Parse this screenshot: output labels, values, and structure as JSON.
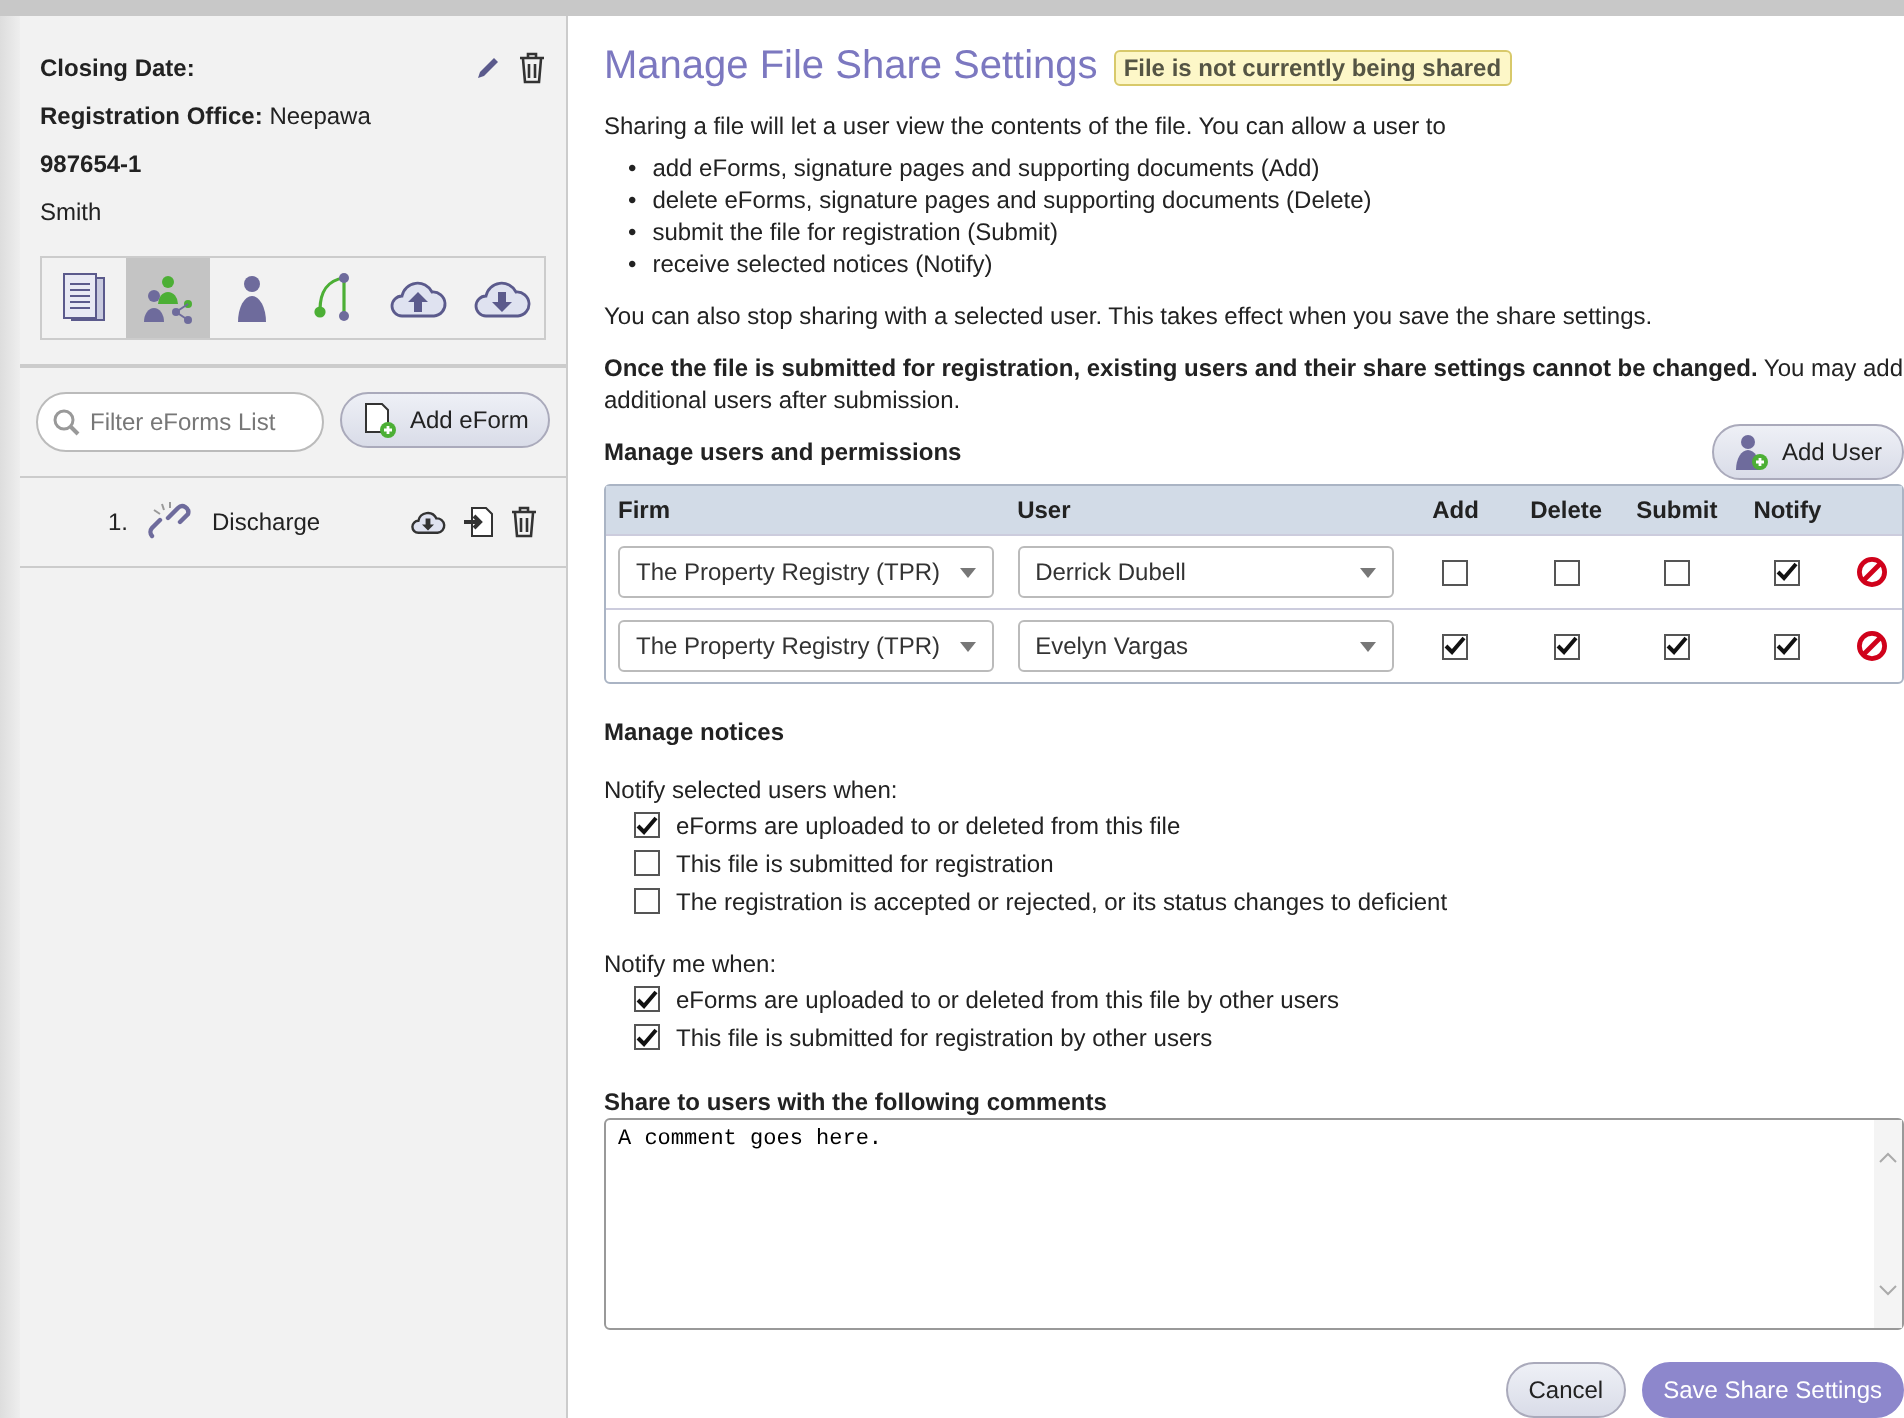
{
  "sidebar": {
    "closing_date_label": "Closing Date:",
    "registration_office_label": "Registration Office:",
    "registration_office": "Neepawa",
    "file_number": "987654-1",
    "name": "Smith",
    "tools": [
      {
        "kind": "document",
        "selected": false
      },
      {
        "kind": "share",
        "selected": true
      },
      {
        "kind": "user",
        "selected": false
      },
      {
        "kind": "branch",
        "selected": false
      },
      {
        "kind": "upload",
        "selected": false
      },
      {
        "kind": "download",
        "selected": false
      }
    ],
    "filter": {
      "placeholder": "Filter eForms List"
    },
    "add_button": "Add eForm",
    "eforms": [
      {
        "number": "1.",
        "name": "Discharge"
      }
    ]
  },
  "main": {
    "title": "Manage File Share Settings",
    "status_badge": "File is not currently being shared",
    "intro": "Sharing a file will let a user view the contents of the file. You can allow a user to",
    "bullets": [
      {
        "marker": "•",
        "text": "add eForms, signature pages and supporting documents (Add)"
      },
      {
        "marker": "•",
        "text": "delete eForms, signature pages and supporting documents (Delete)"
      },
      {
        "marker": "•",
        "text": "submit the file for registration (Submit)"
      },
      {
        "marker": "•",
        "text": "receive selected notices (Notify)"
      }
    ],
    "stop_note": "You can also stop sharing with a selected user. This takes effect when you save the share settings.",
    "submission_note": "**Once the file is submitted for registration, existing users and their share settings cannot be changed.** You may add additional users after submission.",
    "users_heading": "Manage users and permissions",
    "add_user_button": "Add User",
    "table": {
      "columns": [
        "Firm",
        "User",
        "Add",
        "Delete",
        "Submit",
        "Notify"
      ],
      "rows": [
        {
          "firm": "The Property Registry (TPR)",
          "user": "Derrick Dubell",
          "add": false,
          "delete": false,
          "submit": false,
          "notify": true
        },
        {
          "firm": "The Property Registry (TPR)",
          "user": "Evelyn Vargas",
          "add": true,
          "delete": true,
          "submit": true,
          "notify": true
        }
      ]
    },
    "notices_heading": "Manage notices",
    "notice_groups": [
      {
        "label": "Notify selected users when:",
        "options": [
          {
            "label": "eForms are uploaded to or deleted from this file",
            "checked": true
          },
          {
            "label": "This file is submitted for registration",
            "checked": false
          },
          {
            "label": "The registration is accepted or rejected, or its status changes to deficient",
            "checked": false
          }
        ]
      },
      {
        "label": "Notify me when:",
        "options": [
          {
            "label": "eForms are uploaded to or deleted from this file by other users",
            "checked": true
          },
          {
            "label": "This file is submitted for registration by other users",
            "checked": true
          }
        ]
      }
    ],
    "comments_label": "Share to users with the following comments",
    "comments_value": "A comment goes here.",
    "cancel_button": "Cancel",
    "save_button": "Save Share Settings"
  }
}
